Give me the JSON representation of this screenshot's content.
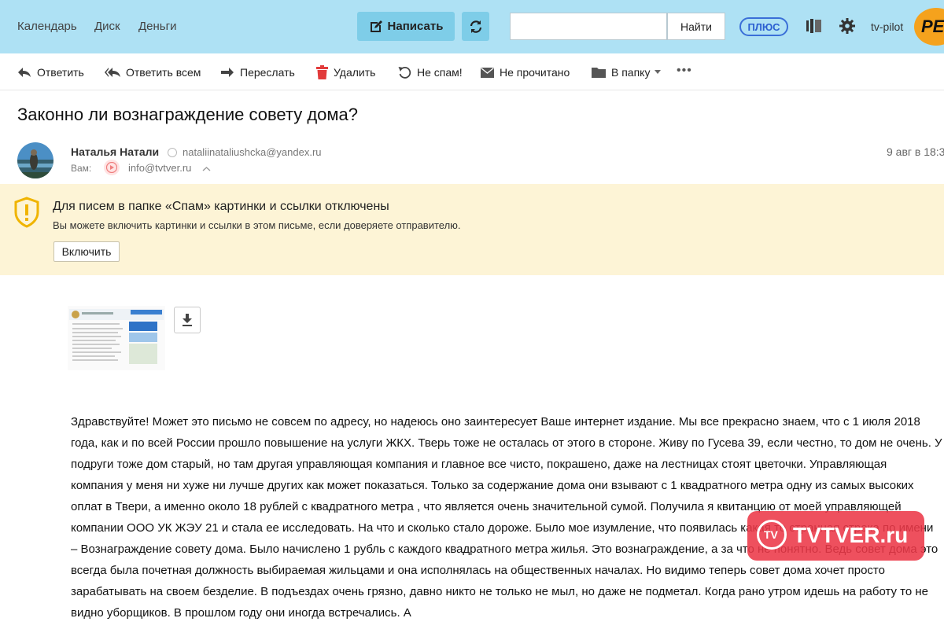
{
  "header": {
    "nav": [
      "Календарь",
      "Диск",
      "Деньги"
    ],
    "compose_label": "Написать",
    "search_placeholder": "",
    "search_button": "Найти",
    "plus_label": "ПЛЮС",
    "username": "tv-pilot",
    "logo_text": "РЕН"
  },
  "toolbar": {
    "reply": "Ответить",
    "reply_all": "Ответить всем",
    "forward": "Переслать",
    "delete": "Удалить",
    "not_spam": "Не спам!",
    "unread": "Не прочитано",
    "to_folder": "В папку",
    "more": "•••"
  },
  "message": {
    "subject": "Законно ли вознаграждение совету дома?",
    "sender_name": "Наталья Натали",
    "sender_email": "nataliinataliushcka@yandex.ru",
    "to_label": "Вам:",
    "to_email": "info@tvtver.ru",
    "date": "9 авг в 18:3"
  },
  "warning": {
    "title": "Для писем в папке «Спам» картинки и ссылки отключены",
    "text": "Вы можете включить картинки и ссылки в этом письме, если доверяете отправителю.",
    "button": "Включить"
  },
  "body": "Здравствуйте! Может это письмо не совсем по адресу, но надеюсь  оно заинтересует  Ваше интернет издание. Мы все прекрасно знаем, что с 1 июля 2018 года, как и по всей России прошло повышение на услуги ЖКХ. Тверь тоже не осталась от этого в стороне. Живу по Гусева 39, если честно, то дом не очень.  У подруги тоже дом старый, но там другая управляющая компания и главное все чисто, покрашено, даже на лестницах стоят цветочки. Управляющая компания у меня ни хуже ни лучше других как может показаться. Только за содержание дома они взывают с 1 квадратного метра одну из самых высоких оплат в Твери, а именно около 18 рублей с квадратного метра , что является очень значительной сумой.  Получила я квитанцию от моей управляющей компании ООО УК ЖЭУ 21 и стала ее исследовать. На что и сколько стало дороже. Было мое изумление, что появилась какая то странная строка по имени – Вознаграждение совету дома. Было начислено 1 рубль с каждого квадратного метра жилья. Это вознаграждение, а за что не понятно. Ведь совет дома это всегда была почетная должность выбираемая жильцами и она исполнялась на общественных началах. Но видимо теперь совет дома хочет просто зарабатывать на своем безделие. В подъездах очень грязно, давно никто не только не мыл, но даже не подметал. Когда рано утром идешь на работу то не видно уборщиков. В прошлом году они иногда встречались. А",
  "watermark": "TVTVER.ru"
}
